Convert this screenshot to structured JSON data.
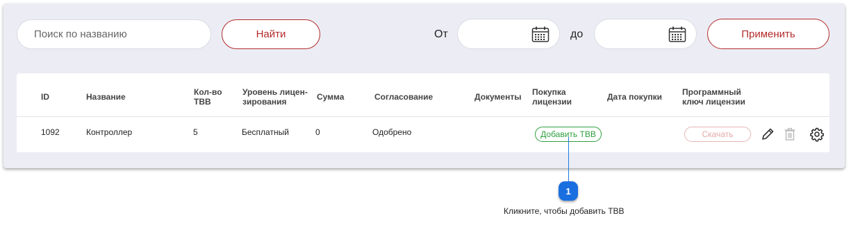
{
  "filters": {
    "search_placeholder": "Поиск по названию",
    "find_label": "Найти",
    "from_label": "От",
    "to_label": "до",
    "apply_label": "Применить"
  },
  "table": {
    "headers": {
      "id": "ID",
      "name": "Название",
      "count_line1": "Кол-во",
      "count_line2": "ТВВ",
      "level_line1": "Уровень лицен-",
      "level_line2": "зирования",
      "sum": "Сумма",
      "approval": "Согласование",
      "documents": "Документы",
      "purchase_line1": "Покупка",
      "purchase_line2": "лицензии",
      "purchase_date": "Дата покупки",
      "key_line1": "Программный",
      "key_line2": "ключ лицензии"
    },
    "rows": [
      {
        "id": "1092",
        "name": "Контроллер",
        "count": "5",
        "level": "Бесплатный",
        "sum": "0",
        "approval": "Одобрено",
        "add_tvv_label": "Добавить ТВВ",
        "download_label": "Скачать"
      }
    ]
  },
  "callout": {
    "number": "1",
    "text": "Кликните, чтобы добавить ТВВ"
  },
  "colors": {
    "accent_red": "#b22a2a",
    "accent_green": "#2e9e3e",
    "callout_blue": "#1a6fe0",
    "panel_bg": "#ecedf4"
  },
  "icons": [
    "calendar-icon",
    "edit-icon",
    "trash-icon",
    "gear-icon"
  ]
}
